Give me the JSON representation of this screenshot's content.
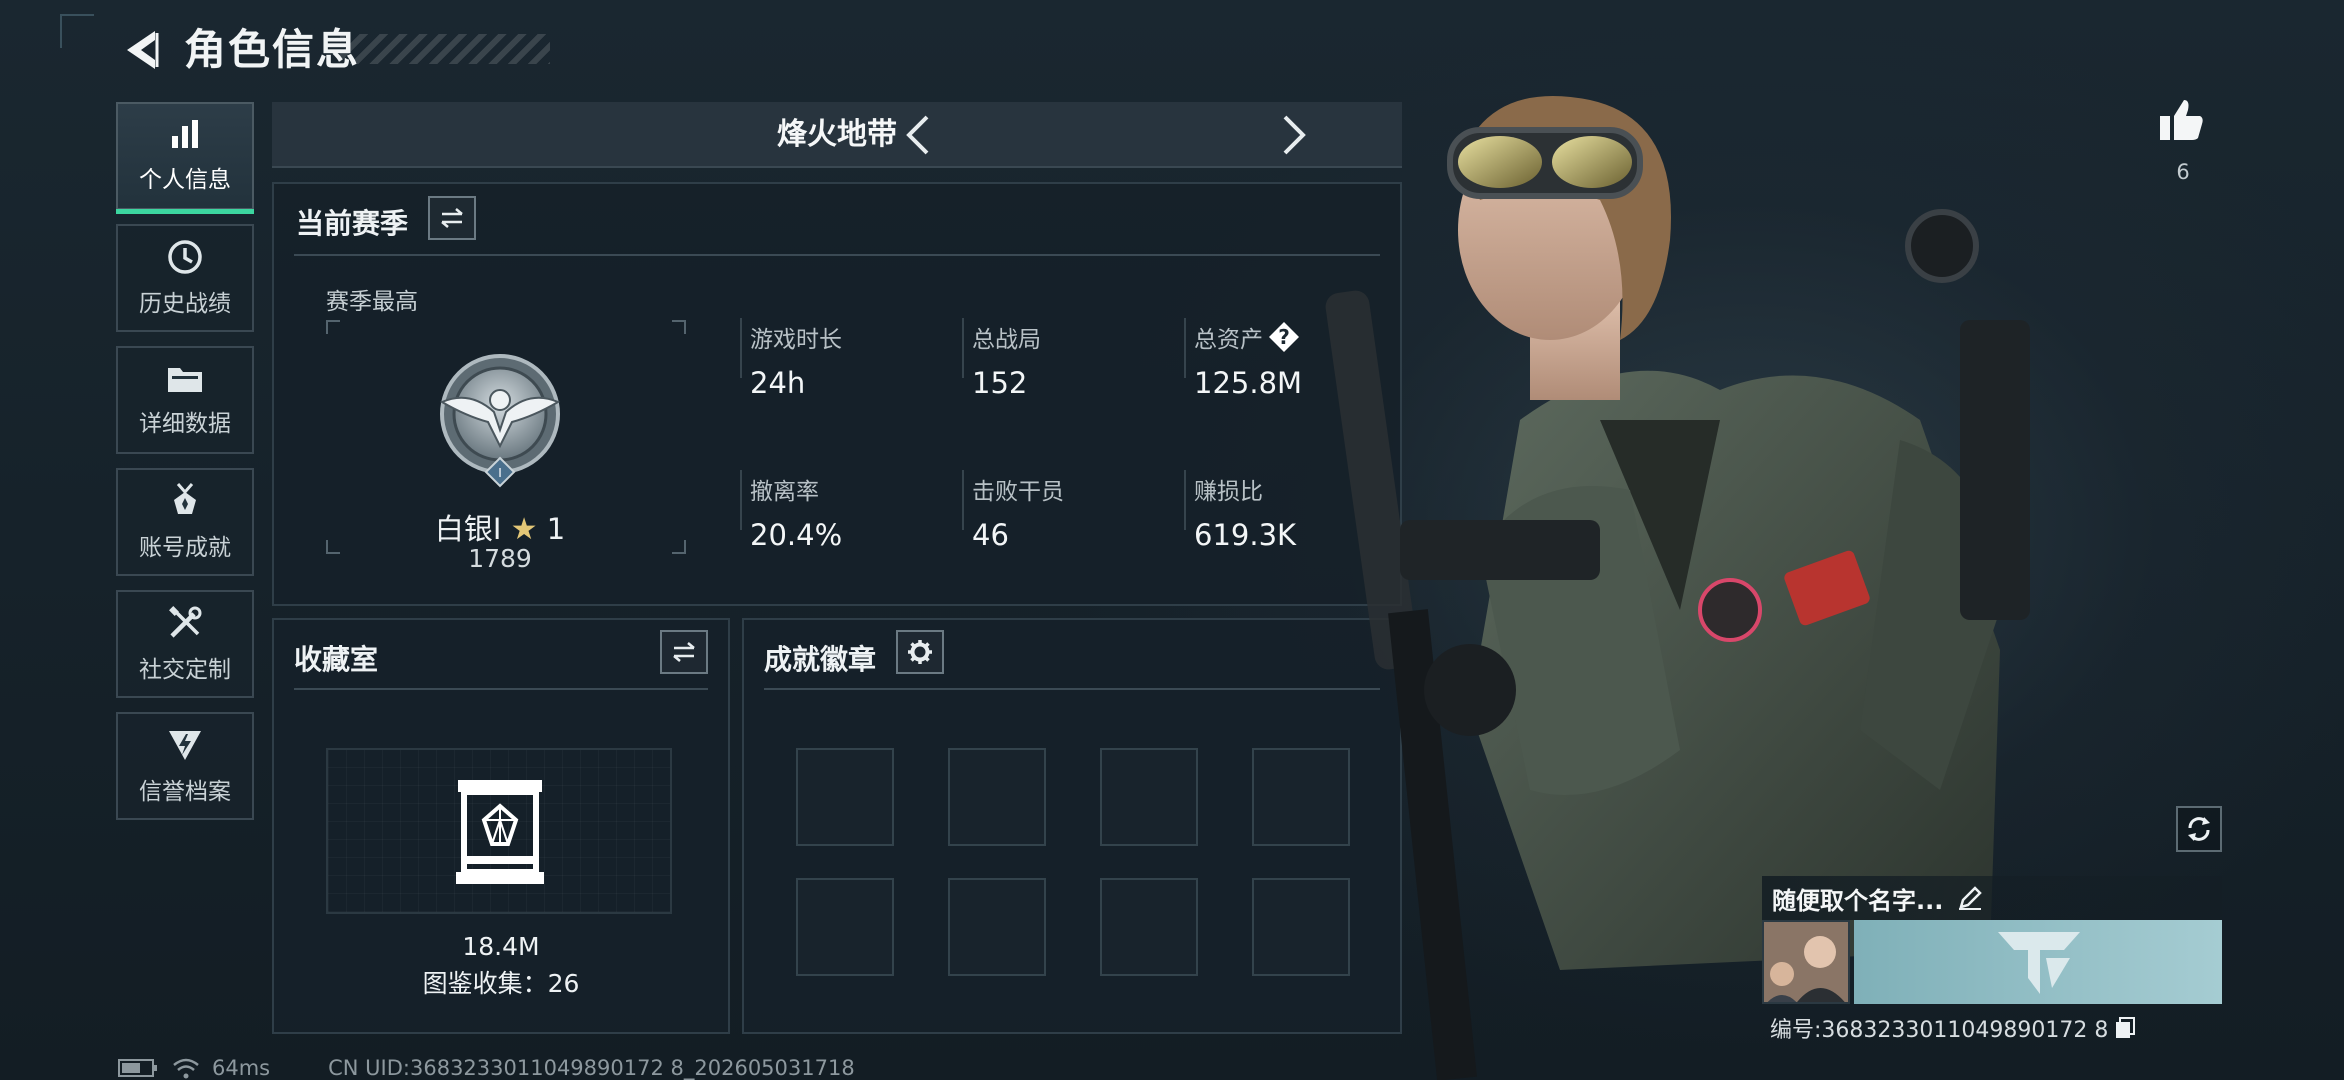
{
  "header": {
    "title": "角色信息"
  },
  "sidebar": {
    "items": [
      {
        "label": "个人信息",
        "icon": "bar-chart-icon",
        "active": true
      },
      {
        "label": "历史战绩",
        "icon": "clock-history-icon",
        "active": false
      },
      {
        "label": "详细数据",
        "icon": "folder-icon",
        "active": false
      },
      {
        "label": "账号成就",
        "icon": "medal-icon",
        "active": false
      },
      {
        "label": "社交定制",
        "icon": "tools-icon",
        "active": false
      },
      {
        "label": "信誉档案",
        "icon": "shield-lightning-icon",
        "active": false
      }
    ]
  },
  "mode": {
    "name": "烽火地带"
  },
  "season": {
    "title": "当前赛季",
    "best_label": "赛季最高",
    "rank_name": "白银Ⅰ",
    "rank_stars": "1",
    "rank_score": "1789",
    "stats": [
      {
        "label": "游戏时长",
        "value": "24h"
      },
      {
        "label": "总战局",
        "value": "152"
      },
      {
        "label": "总资产",
        "value": "125.8M",
        "has_help": true
      },
      {
        "label": "撤离率",
        "value": "20.4%"
      },
      {
        "label": "击败干员",
        "value": "46"
      },
      {
        "label": "赚损比",
        "value": "619.3K"
      }
    ],
    "help_symbol": "?"
  },
  "collection": {
    "title": "收藏室",
    "value": "18.4M",
    "catalog_label": "图鉴收集：26"
  },
  "achievements": {
    "title": "成就徽章",
    "slots": 8
  },
  "profile": {
    "likes": "6",
    "player_name": "随便取个名字...",
    "id_label": "编号:3683233011049890172 8"
  },
  "footer": {
    "ping": "64ms",
    "uid": "CN UID:3683233011049890172 8_202605031718"
  },
  "colors": {
    "accent_green": "#3cd6a0",
    "panel_border": "#2f3e48",
    "banner_teal": "#9fc8cf"
  }
}
